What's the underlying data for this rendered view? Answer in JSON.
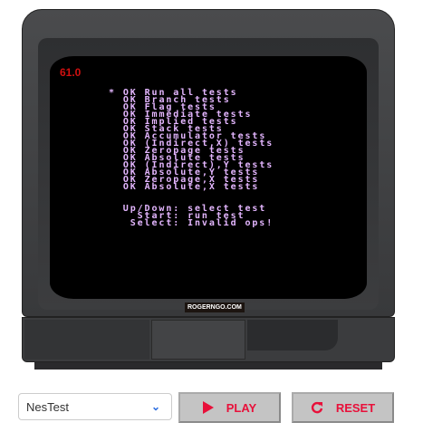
{
  "screen": {
    "fps": "61.0",
    "cursor": "*",
    "lines": [
      "OK Run all tests",
      "OK Branch tests",
      "OK Flag tests",
      "OK Immediate tests",
      "OK Implied tests",
      "OK Stack tests",
      "OK Accumulator tests",
      "OK (Indirect,X) tests",
      "OK Zeropage tests",
      "OK Absolute tests",
      "OK (Indirect),Y tests",
      "OK Absolute,Y tests",
      "OK Zeropage,X tests",
      "OK Absolute,X tests"
    ],
    "help": [
      "Up/Down: select test",
      "  Start: run test",
      " Select: Invalid ops!"
    ]
  },
  "tv": {
    "brand": "ROGERNGO.COM"
  },
  "controls": {
    "rom_select": "NesTest",
    "play_label": "PLAY",
    "reset_label": "RESET"
  },
  "colors": {
    "text": "#e4b6ff",
    "fps": "#d01010",
    "accent": "#e8103a"
  }
}
